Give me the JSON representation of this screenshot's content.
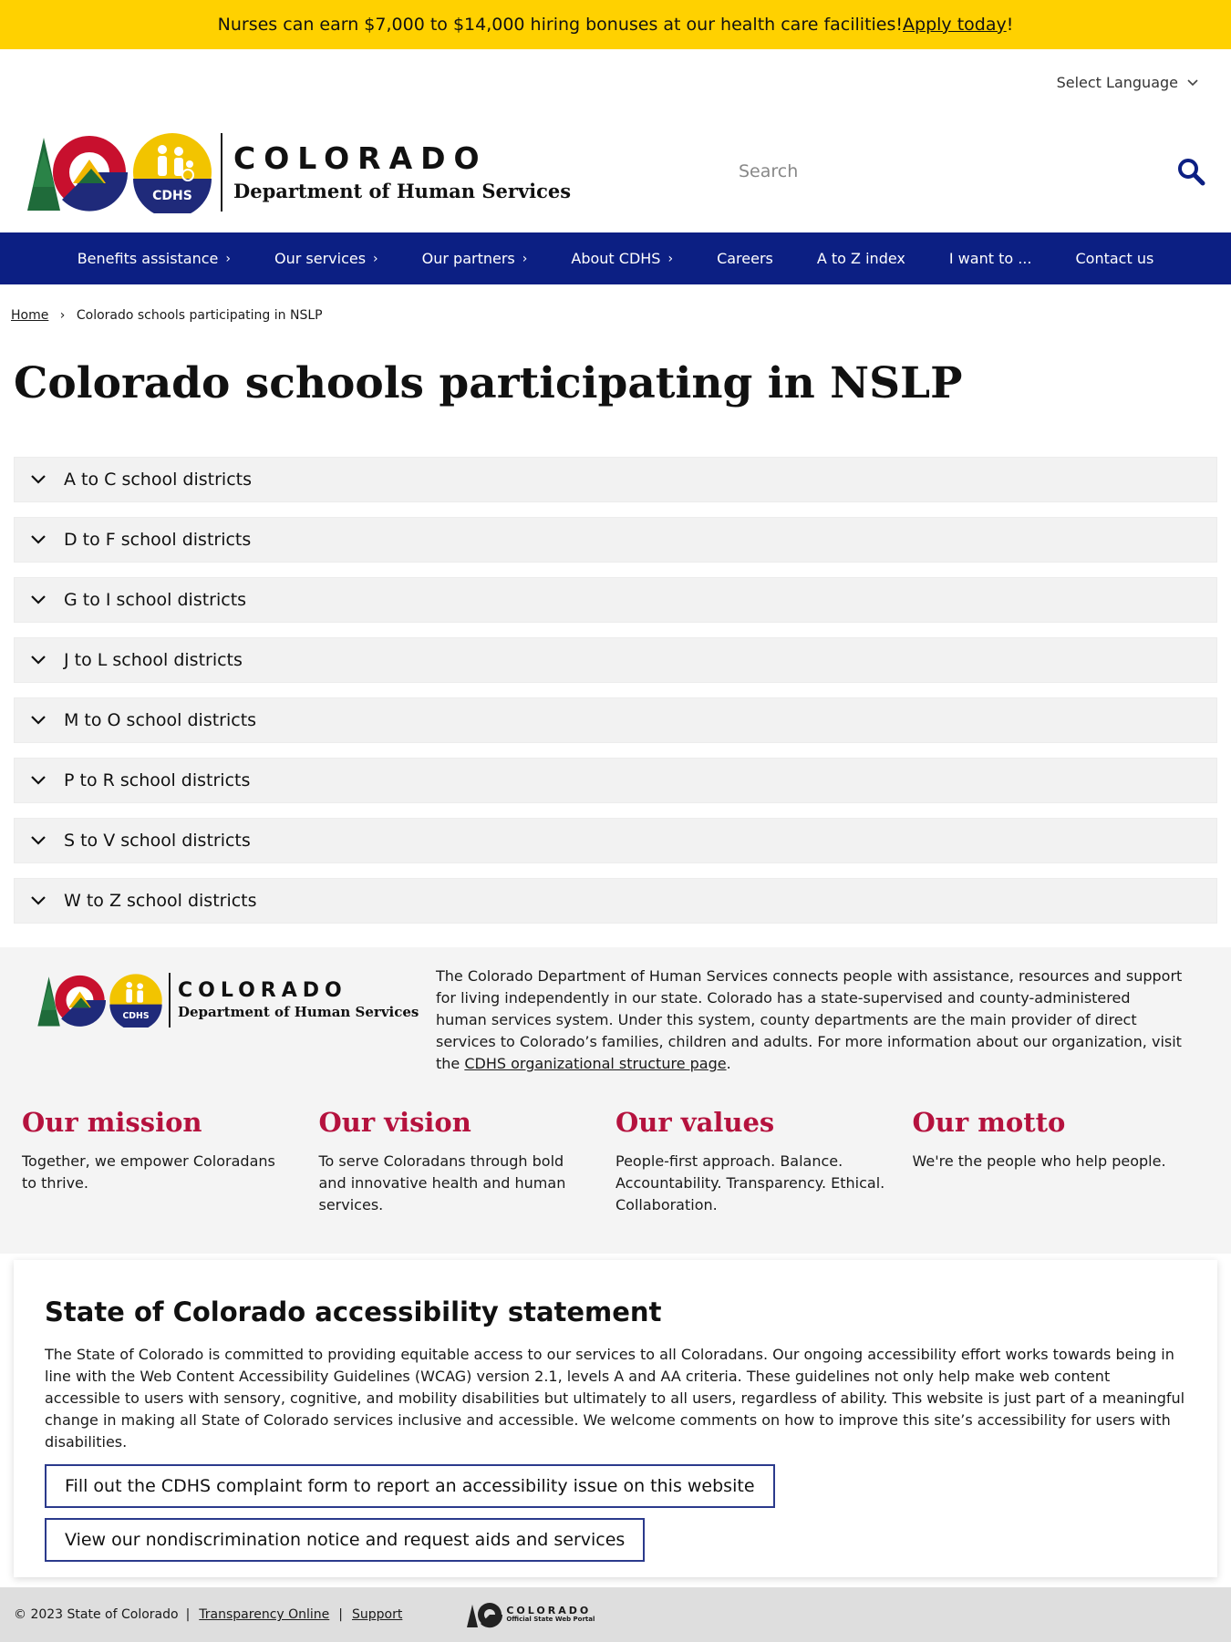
{
  "alert": {
    "text": "Nurses can earn $7,000 to $14,000 hiring bonuses at our health care facilities! ",
    "link": "Apply today",
    "suffix": "!"
  },
  "language": {
    "label": "Select Language",
    "icon": "chevron-down-icon"
  },
  "header": {
    "logo_title": "COLORADO",
    "logo_subtitle": "Department of Human Services",
    "logo_badge": "CDHS",
    "search_placeholder": "Search",
    "search_icon": "search-icon"
  },
  "nav": [
    {
      "label": "Benefits assistance",
      "has_submenu": true
    },
    {
      "label": "Our services",
      "has_submenu": true
    },
    {
      "label": "Our partners",
      "has_submenu": true
    },
    {
      "label": "About CDHS",
      "has_submenu": true
    },
    {
      "label": "Careers",
      "has_submenu": false
    },
    {
      "label": "A to Z index",
      "has_submenu": false
    },
    {
      "label": "I want to ...",
      "has_submenu": false
    },
    {
      "label": "Contact us",
      "has_submenu": false
    }
  ],
  "breadcrumb": {
    "home": "Home",
    "separator": "›",
    "current": "Colorado schools participating in NSLP"
  },
  "page": {
    "title": "Colorado schools participating in NSLP"
  },
  "accordion": [
    {
      "label": "A to C school districts"
    },
    {
      "label": "D to F school districts"
    },
    {
      "label": "G to I school districts"
    },
    {
      "label": "J to L school districts"
    },
    {
      "label": "M to O school districts"
    },
    {
      "label": "P to R school districts"
    },
    {
      "label": "S to V school districts"
    },
    {
      "label": "W to Z school districts"
    }
  ],
  "footer": {
    "about_text": "The Colorado Department of Human Services connects people with assistance, resources and support for living independently in our state. Colorado has a state-supervised and county-administered human services system. Under this system, county departments are the main provider of direct services to Colorado’s families, children and adults. For more information about our organization, visit the ",
    "about_link": "CDHS organizational structure page",
    "about_suffix": ".",
    "values": [
      {
        "title": "Our mission",
        "text": "Together, we empower Coloradans to thrive."
      },
      {
        "title": "Our vision",
        "text": "To serve Coloradans through bold and innovative health and human services."
      },
      {
        "title": "Our values",
        "text": "People-first approach. Balance. Accountability. Transparency. Ethical. Collaboration."
      },
      {
        "title": "Our motto",
        "text": "We're the people who help people."
      }
    ]
  },
  "accessibility": {
    "title": "State of Colorado accessibility statement",
    "text": "The State of Colorado is committed to providing equitable access to our services to all Coloradans. Our ongoing accessibility effort works towards being in line with the Web Content Accessibility Guidelines (WCAG) version 2.1, levels A and AA criteria. These guidelines not only help make web content accessible to users with sensory, cognitive, and mobility disabilities but ultimately to all users, regardless of ability. This website is just part of a meaningful change in making all State of Colorado services inclusive and accessible. We welcome comments on how to improve this site’s accessibility for users with disabilities.",
    "button1": "Fill out the CDHS complaint form to report an accessibility issue on this website",
    "button2": "View our nondiscrimination notice and request aids and services"
  },
  "bottom": {
    "copyright": "© 2023 State of Colorado",
    "pipe": "|",
    "link1": "Transparency Online",
    "link2": "Support",
    "portal_title": "COLORADO",
    "portal_subtitle": "Official State Web Portal"
  },
  "colors": {
    "alert_bg": "#ffd100",
    "nav_bg": "#0c1f83",
    "accent_red": "#b5123e",
    "footer_bg": "#f4f4f4",
    "bottom_bg": "#dedede"
  }
}
